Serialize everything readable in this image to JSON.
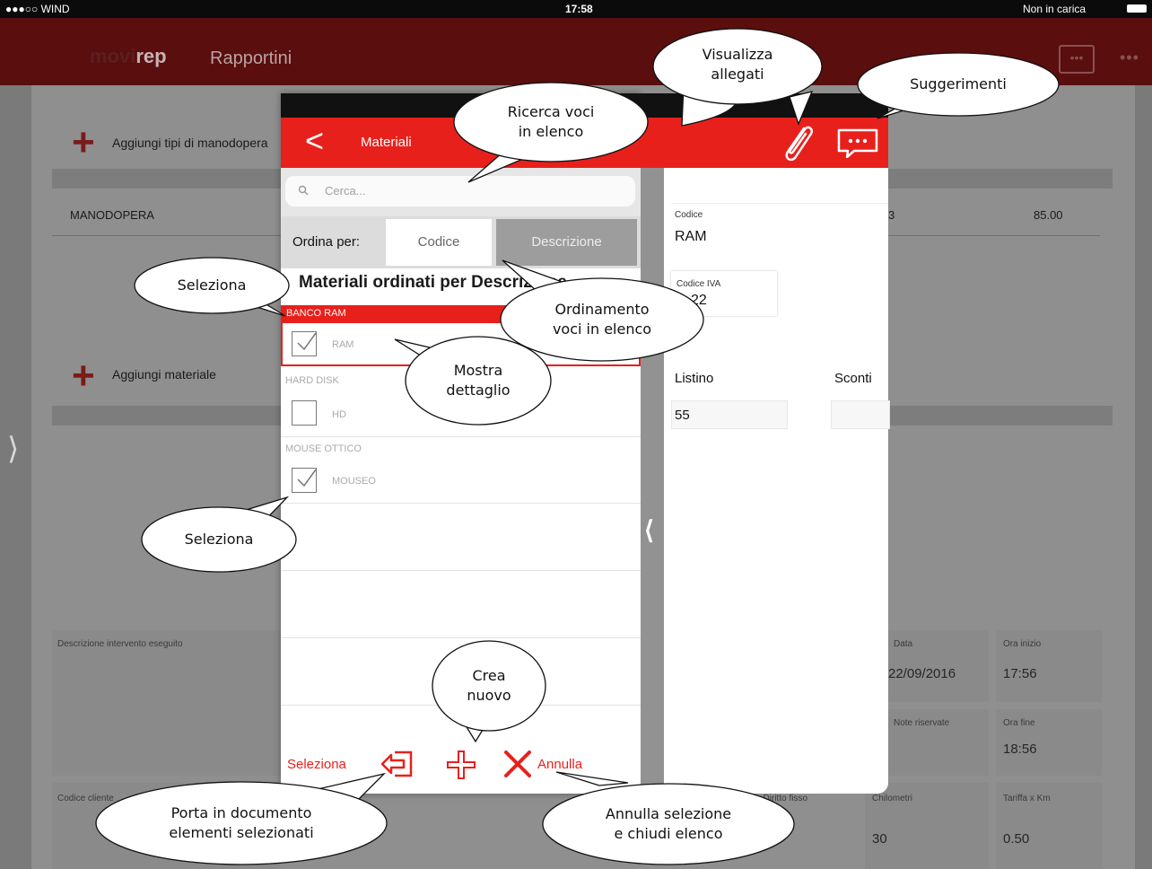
{
  "status_bar": {
    "carrier": "●●●○○ WIND",
    "wifi": "WiFi",
    "time": "17:58",
    "battery_text": "Non in carica"
  },
  "app_header": {
    "brand_a": "movi",
    "brand_b": "rep",
    "section": "Rapportini"
  },
  "background": {
    "add_labour_label": "Aggiungi tipi di manodopera",
    "labour_row_name": "MANODOPERA",
    "labour_row_qty": "3",
    "labour_row_total": "85.00",
    "add_material_label": "Aggiungi materiale",
    "intervention_label": "Descrizione intervento eseguito",
    "date_label": "Data",
    "date_value": "22/09/2016",
    "start_label": "Ora inizio",
    "start_value": "17:56",
    "notes_label": "Note riservate",
    "end_label": "Ora fine",
    "end_value": "18:56",
    "code_label": "Codice cliente",
    "fixed_label": "Diritto fisso",
    "km_label": "Chilometri",
    "km_value": "30",
    "rate_label": "Tariffa x Km",
    "rate_value": "0.50"
  },
  "modal": {
    "title": "Materiali",
    "search_placeholder": "Cerca...",
    "sort_label": "Ordina per:",
    "sort_options": [
      "Codice",
      "Descrizione"
    ],
    "sort_selected": "Descrizione",
    "list_heading": "Materiali ordinati per Descrizione",
    "groups": [
      {
        "header": "BANCO RAM",
        "item": "RAM",
        "checked": true,
        "highlighted": true
      },
      {
        "header": "HARD DISK",
        "item": "HD",
        "checked": false,
        "highlighted": false
      },
      {
        "header": "MOUSE OTTICO",
        "item": "MOUSEO",
        "checked": true,
        "highlighted": false
      }
    ],
    "select_label": "Seleziona",
    "cancel_label": "Annulla"
  },
  "detail": {
    "code_label": "Codice",
    "code_value": "RAM",
    "vat_label": "Codice IVA",
    "vat_value": "22",
    "price_label": "Listino",
    "price_value": "55",
    "discount_label": "Sconti"
  },
  "callouts": {
    "attachments": [
      "Visualizza",
      "allegati"
    ],
    "suggestions": "Suggerimenti",
    "search": [
      "Ricerca voci",
      "in elenco"
    ],
    "select_top": "Seleziona",
    "sort": [
      "Ordinamento",
      "voci in elenco"
    ],
    "detail": [
      "Mostra",
      "dettaglio"
    ],
    "select_bottom": "Seleziona",
    "create": [
      "Crea",
      "nuovo"
    ],
    "bring": [
      "Porta in documento",
      "elementi selezionati"
    ],
    "cancel": [
      "Annulla selezione",
      "e chiudi elenco"
    ]
  },
  "colors": {
    "accent": "#e8201c",
    "header_dark": "#5a0e0e"
  }
}
